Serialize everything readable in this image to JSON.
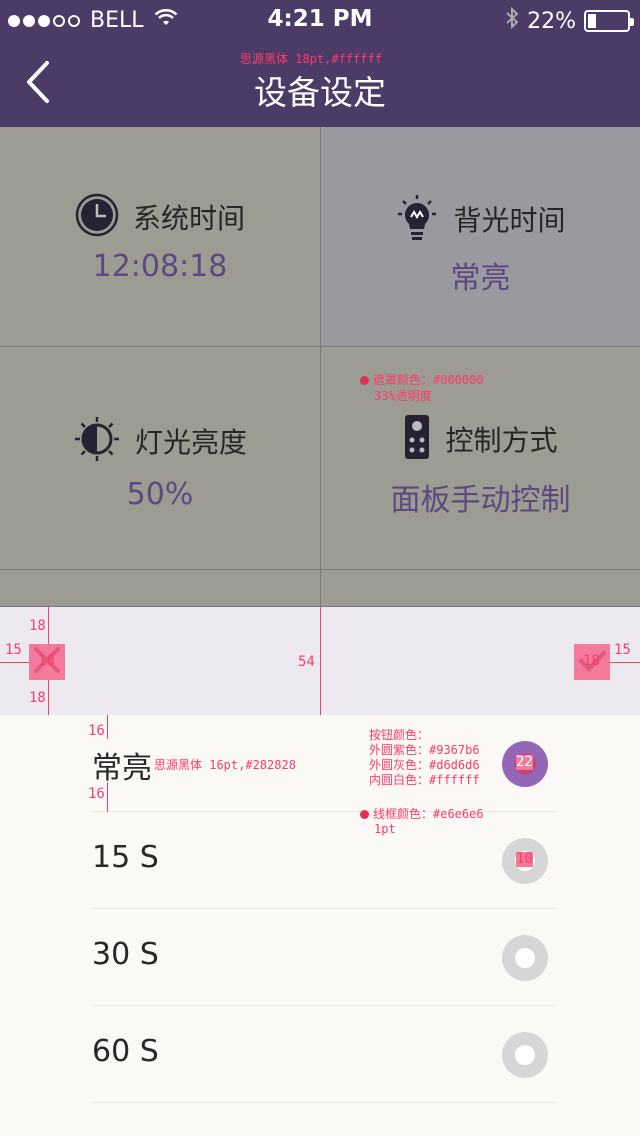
{
  "status_bar": {
    "carrier": "BELL",
    "time": "4:21 PM",
    "battery_percent": "22%",
    "battery_level": 0.22,
    "signal_dots": [
      true,
      true,
      true,
      false,
      false
    ]
  },
  "nav": {
    "back_icon": "chevron-left-icon",
    "title": "设备设定",
    "title_annotation": "思源黑体 18pt,#ffffff"
  },
  "settings": [
    {
      "label": "系统时间",
      "value": "12:08:18",
      "icon": "clock-icon"
    },
    {
      "label": "背光时间",
      "value": "常亮",
      "icon": "bulb-icon"
    },
    {
      "label": "灯光亮度",
      "value": "50%",
      "icon": "brightness-icon"
    },
    {
      "label": "控制方式",
      "value": "面板手动控制",
      "icon": "remote-icon"
    }
  ],
  "mask_annotation": {
    "line1": "遮罩颜色：#000000",
    "line2": "33%透明度"
  },
  "popup": {
    "cancel_icon": "close-icon",
    "confirm_icon": "check-icon",
    "dims": {
      "top": "18",
      "left": "15",
      "icon": "18",
      "bottom": "18",
      "height": "54",
      "right_icon": "18",
      "right": "15"
    }
  },
  "options": [
    {
      "label": "常亮",
      "selected": true
    },
    {
      "label": "15 S",
      "selected": false
    },
    {
      "label": "30 S",
      "selected": false
    },
    {
      "label": "60 S",
      "selected": false
    }
  ],
  "option_annotations": {
    "font": "思源黑体 16pt,#282828",
    "pad_top": "16",
    "pad_bottom": "16",
    "button_title": "按钮颜色：",
    "outer_purple": "外圆紫色：#9367b6",
    "outer_gray": "外圆灰色：#d6d6d6",
    "inner_white": "内圆白色：#ffffff",
    "selected_size": "22",
    "unselected_size": "10",
    "border_color": "线框颜色：#e6e6e6",
    "border_width": "1pt"
  },
  "colors": {
    "header": "#4b3b66",
    "value_text": "#5e4880",
    "accent": "#9367b6"
  }
}
